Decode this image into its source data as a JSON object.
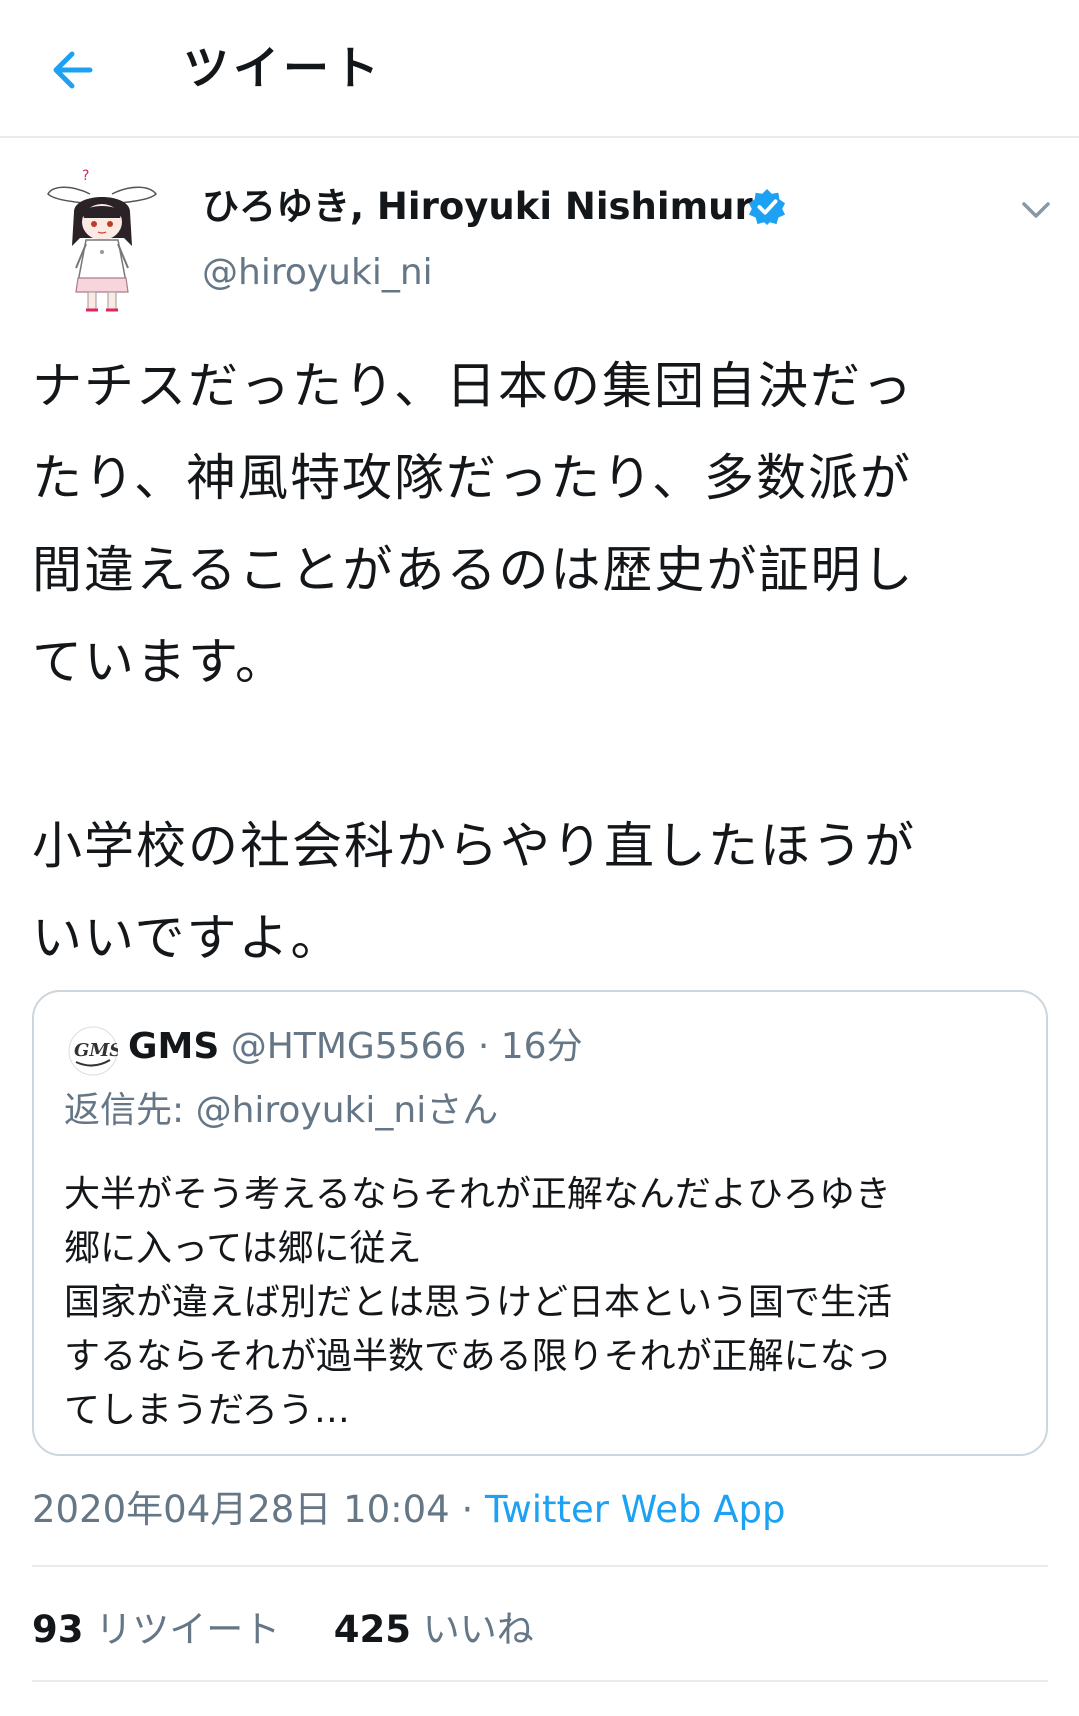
{
  "header": {
    "title": "ツイート",
    "back_icon": "arrow-left-icon",
    "accent_color": "#1da1f2"
  },
  "author": {
    "display_name": "ひろゆき, Hiroyuki Nishimura",
    "handle": "@hiroyuki_ni",
    "verified": true,
    "verified_icon": "verified-badge-icon",
    "menu_icon": "chevron-down-icon"
  },
  "tweet": {
    "text": "ナチスだったり、日本の集団自決だっ\nたり、神風特攻隊だったり、多数派が\n間違えることがあるのは歴史が証明し\nています。\n\n小学校の社会科からやり直したほうが\nいいですよ。"
  },
  "quote": {
    "name": "GMS",
    "handle": "@HTMG5566",
    "separator": "·",
    "time": "16分",
    "reply_to": "返信先: @hiroyuki_niさん",
    "text": "大半がそう考えるならそれが正解なんだよひろゆき\n郷に入っては郷に従え\n国家が違えば別だとは思うけど日本という国で生活\nするならそれが過半数である限りそれが正解になっ\nてしまうだろう…"
  },
  "meta": {
    "timestamp": "2020年04月28日 10:04",
    "separator": "·",
    "source": "Twitter Web App"
  },
  "stats": {
    "retweets_count": "93",
    "retweets_label": "リツイート",
    "likes_count": "425",
    "likes_label": "いいね"
  }
}
